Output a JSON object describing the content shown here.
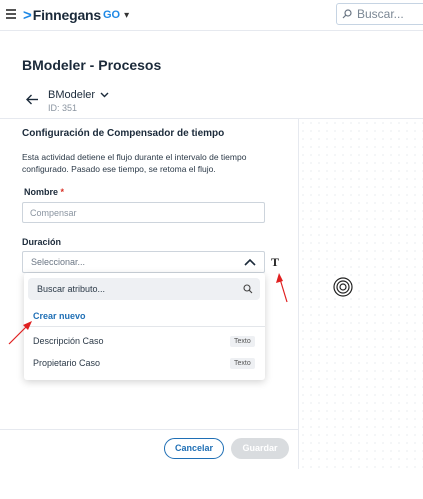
{
  "header": {
    "logo_name": "Finnegans",
    "logo_suffix": "GO",
    "search_placeholder": "Buscar..."
  },
  "page": {
    "title": "BModeler - Procesos",
    "process_name": "BModeler",
    "process_id": "ID: 351"
  },
  "form": {
    "section_title": "Configuración de Compensador de tiempo",
    "description": "Esta actividad detiene el flujo durante el intervalo de tiempo configurado. Pasado ese tiempo, se retoma el flujo.",
    "name_label": "Nombre",
    "required_mark": "*",
    "name_placeholder": "Compensar",
    "duration_label": "Duración",
    "duration_value": "Seleccionar...",
    "type_icon_text": "T"
  },
  "dropdown": {
    "search_placeholder": "Buscar atributo...",
    "create_new": "Crear nuevo",
    "items": [
      {
        "label": "Descripción Caso",
        "badge": "Texto"
      },
      {
        "label": "Propietario Caso",
        "badge": "Texto"
      }
    ]
  },
  "footer": {
    "cancel_label": "Cancelar",
    "save_label": "Guardar"
  },
  "colors": {
    "accent": "#1f6fb5",
    "annotation": "#e02020",
    "disabled": "#d9dcdf"
  }
}
